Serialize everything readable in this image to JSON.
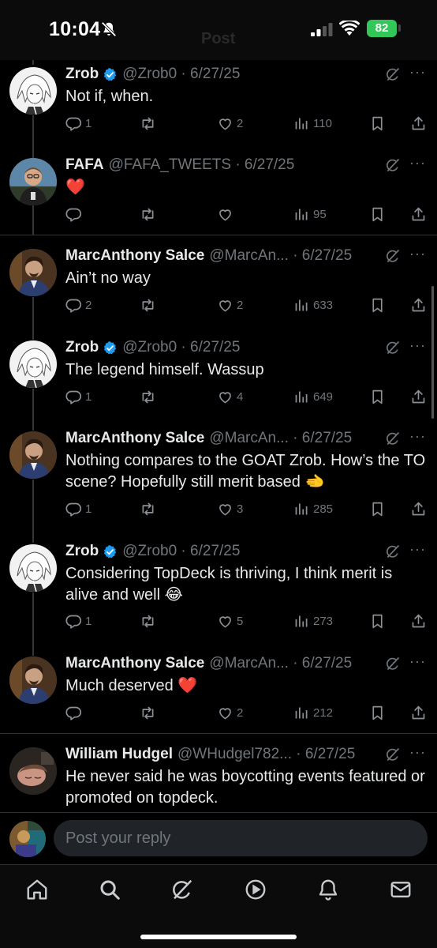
{
  "status": {
    "time": "10:04",
    "battery": "82",
    "header_ghost": "Post"
  },
  "icons": {
    "reply": "reply-icon",
    "repost": "repost-icon",
    "like": "like-icon",
    "views": "views-icon",
    "bookmark": "bookmark-icon",
    "share": "share-icon",
    "verified": "verified-badge-icon",
    "grok": "grok-icon",
    "more": "more-icon"
  },
  "colors": {
    "accent": "#1d9bf0",
    "muted": "#71767b",
    "heart": "#f91880",
    "background": "#000000"
  },
  "tweets": [
    {
      "name": "Zrob",
      "verified": true,
      "handle": "@Zrob0 · 6/27/25",
      "text": "Not if, when.",
      "replies": "1",
      "reposts": "",
      "likes": "2",
      "views": "110"
    },
    {
      "name": "FAFA",
      "verified": false,
      "handle": "@FAFA_TWEETS · 6/27/25",
      "text": "❤️",
      "replies": "",
      "reposts": "",
      "likes": "",
      "views": "95"
    },
    {
      "name": "MarcAnthony Salce",
      "verified": false,
      "handle": "@MarcAn... · 6/27/25",
      "text": "Ain’t no way",
      "replies": "2",
      "reposts": "",
      "likes": "2",
      "views": "633"
    },
    {
      "name": "Zrob",
      "verified": true,
      "handle": "@Zrob0 · 6/27/25",
      "text": "The legend himself. Wassup",
      "replies": "1",
      "reposts": "",
      "likes": "4",
      "views": "649"
    },
    {
      "name": "MarcAnthony Salce",
      "verified": false,
      "handle": "@MarcAn... · 6/27/25",
      "text": "Nothing compares to the GOAT Zrob. How’s the TO scene? Hopefully still merit based 🫲",
      "replies": "1",
      "reposts": "",
      "likes": "3",
      "views": "285"
    },
    {
      "name": "Zrob",
      "verified": true,
      "handle": "@Zrob0 · 6/27/25",
      "text": "Considering TopDeck is thriving, I think merit is alive and well 😂",
      "replies": "1",
      "reposts": "",
      "likes": "5",
      "views": "273"
    },
    {
      "name": "MarcAnthony Salce",
      "verified": false,
      "handle": "@MarcAn... · 6/27/25",
      "text": "Much deserved ❤️",
      "replies": "",
      "reposts": "",
      "likes": "2",
      "views": "212"
    },
    {
      "name": "William Hudgel",
      "verified": false,
      "handle": "@WHudgel782... · 6/27/25",
      "text": "He never said he was boycotting events featured or promoted on topdeck.",
      "replies": "",
      "reposts": "",
      "likes": "",
      "views": ""
    }
  ],
  "reply_bar": {
    "placeholder": "Post your reply"
  },
  "tabs": [
    "home-icon",
    "search-icon",
    "grok-icon",
    "video-icon",
    "notifications-icon",
    "messages-icon"
  ]
}
